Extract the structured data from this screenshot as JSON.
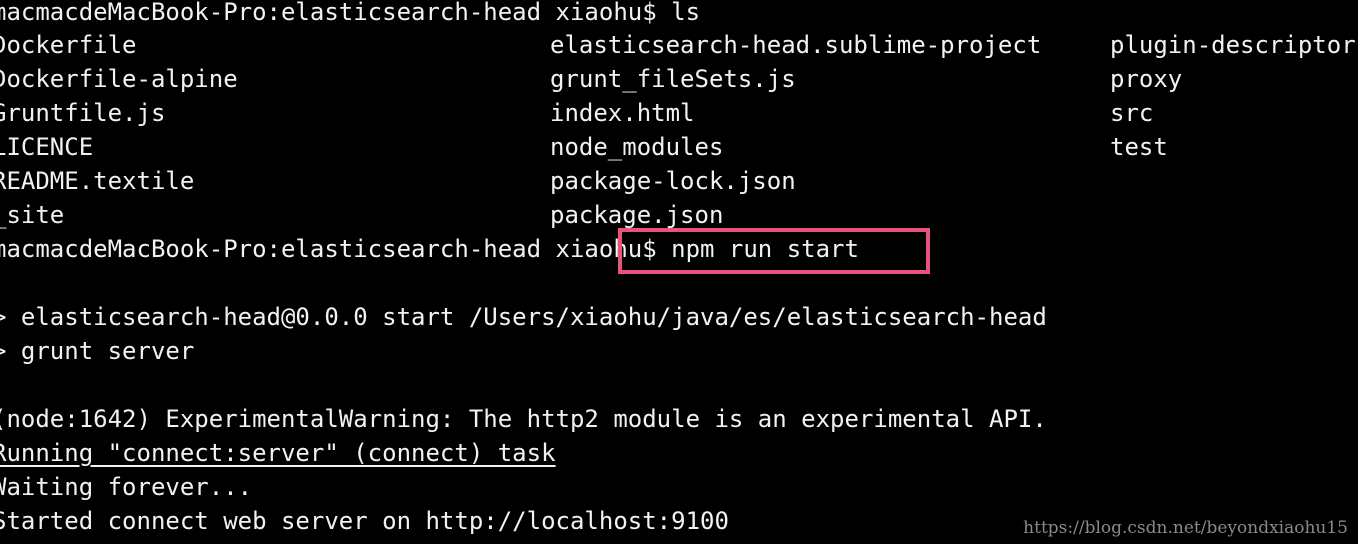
{
  "terminal": {
    "prompt1": "macmacdeMacBook-Pro:elasticsearch-head xiaohu$ ls",
    "ls_col1": [
      "Dockerfile",
      "Dockerfile-alpine",
      "Gruntfile.js",
      "LICENCE",
      "README.textile",
      "_site"
    ],
    "ls_col2": [
      "elasticsearch-head.sublime-project",
      "grunt_fileSets.js",
      "index.html",
      "node_modules",
      "package-lock.json",
      "package.json"
    ],
    "ls_col3": [
      "plugin-descriptor.",
      "proxy",
      "src",
      "test"
    ],
    "prompt2": "macmacdeMacBook-Pro:elasticsearch-head xiaohu$ npm run start",
    "npm_line1": "> elasticsearch-head@0.0.0 start /Users/xiaohu/java/es/elasticsearch-head",
    "npm_line2": "> grunt server",
    "warning": "(node:1642) ExperimentalWarning: The http2 module is an experimental API.",
    "running": "Running \"connect:server\" (connect) task",
    "waiting": "Waiting forever...",
    "started": "Started connect web server on http://localhost:9100"
  },
  "watermark": "https://blog.csdn.net/beyondxiaohu15",
  "colors": {
    "background": "#000000",
    "text": "#f2f2f2",
    "highlight": "#e8537a"
  }
}
